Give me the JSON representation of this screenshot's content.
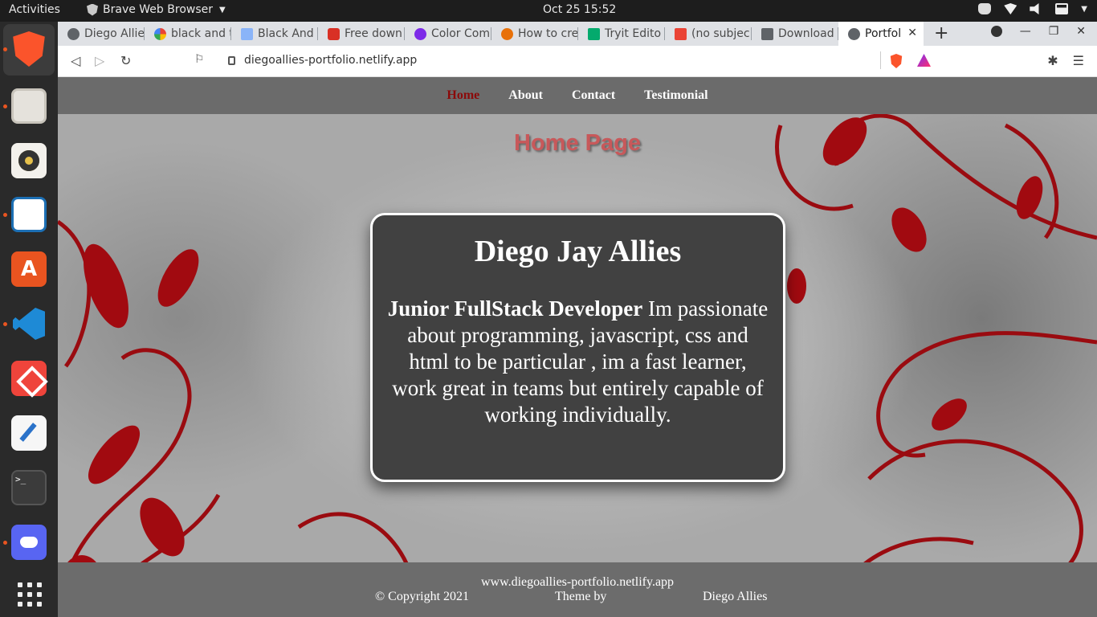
{
  "system": {
    "activities": "Activities",
    "app_name": "Brave Web Browser",
    "clock": "Oct 25  15:52"
  },
  "dock": {
    "apps": [
      "brave-browser",
      "files",
      "rhythmbox",
      "libreoffice-writer",
      "ubuntu-software",
      "vscode",
      "anydesk",
      "text-editor",
      "terminal",
      "discord",
      "show-applications"
    ],
    "terminal_glyph": ">_"
  },
  "browser": {
    "tabs": [
      {
        "label": "Diego Allie",
        "favicon": "globe-icon",
        "color": "#5f6368"
      },
      {
        "label": "black and t",
        "favicon": "google-icon",
        "color": "#4285f4"
      },
      {
        "label": "Black And",
        "favicon": "wix-icon",
        "color": "#8ab4f8"
      },
      {
        "label": "Free down",
        "favicon": "freepik-icon",
        "color": "#d93025"
      },
      {
        "label": "Color Com",
        "favicon": "canva-icon",
        "color": "#7d2ae8"
      },
      {
        "label": "How to cre",
        "favicon": "howto-icon",
        "color": "#e8710a"
      },
      {
        "label": "Tryit Edito",
        "favicon": "w3schools-icon",
        "color": "#04aa6d"
      },
      {
        "label": "(no subjec",
        "favicon": "gmail-icon",
        "color": "#ea4335"
      },
      {
        "label": "Download",
        "favicon": "download-icon",
        "color": "#5f6368"
      },
      {
        "label": "Portfol",
        "favicon": "globe-icon",
        "color": "#5f6368",
        "active": true
      }
    ],
    "url": "diegoallies-portfolio.netlify.app"
  },
  "site": {
    "nav": [
      "Home",
      "About",
      "Contact",
      "Testimonial"
    ],
    "page_title": "Home Page",
    "name": "Diego Jay Allies",
    "role": "Junior FullStack Developer",
    "bio": " Im passionate about programming, javascript, css and html to be particular , im a fast learner, work great in teams but entirely capable of working individually.",
    "footer": {
      "site": "www.diegoallies-portfolio.netlify.app",
      "copyright": "© Copyright 2021",
      "theme": "Theme by",
      "author": "Diego Allies"
    },
    "colors": {
      "accent_red": "#8b0a0a",
      "title_red": "#c8585a",
      "card_bg": "#414141"
    }
  }
}
